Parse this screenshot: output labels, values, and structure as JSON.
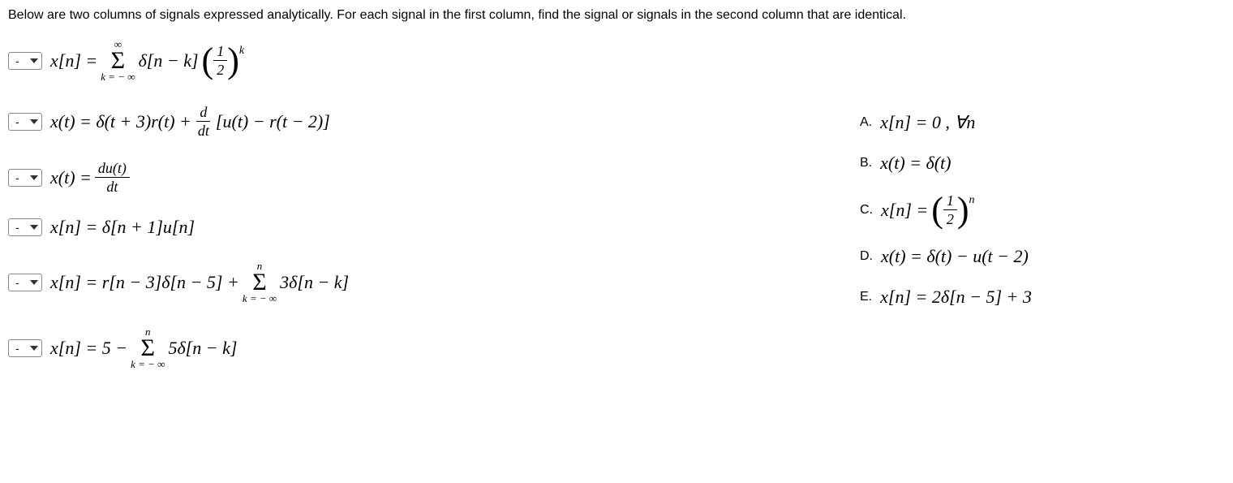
{
  "prompt": "Below are two columns of signals expressed analytically. For each signal in the first column, find the signal or signals in the second column that are identical.",
  "dropdown_value": "-",
  "questions": {
    "q1": {
      "x_label": "x[n] =",
      "sum_upper": "∞",
      "sum_lower": "k = − ∞",
      "body": "δ[n − k]",
      "frac_num": "1",
      "frac_den": "2",
      "exp": "k"
    },
    "q2": {
      "x_label": "x(t) = δ(t + 3)r(t) +",
      "frac_num": "d",
      "frac_den": "dt",
      "tail": "[u(t) − r(t − 2)]"
    },
    "q3": {
      "x_label": "x(t) =",
      "frac_num": "du(t)",
      "frac_den": "dt"
    },
    "q4": {
      "x_label": "x[n] = δ[n + 1]u[n]"
    },
    "q5": {
      "x_label": "x[n] = r[n − 3]δ[n − 5] +",
      "sum_upper": "n",
      "sum_lower": "k = − ∞",
      "tail": "3δ[n − k]"
    },
    "q6": {
      "x_label": "x[n] = 5 −",
      "sum_upper": "n",
      "sum_lower": "k = − ∞",
      "tail": "5δ[n − k]"
    }
  },
  "options": {
    "A": {
      "label": "A.",
      "text": "x[n] = 0 ,  ∀n"
    },
    "B": {
      "label": "B.",
      "text": "x(t) = δ(t)"
    },
    "C": {
      "label": "C.",
      "pre": "x[n] =",
      "frac_num": "1",
      "frac_den": "2",
      "exp": "n"
    },
    "D": {
      "label": "D.",
      "text": "x(t) = δ(t) − u(t − 2)"
    },
    "E": {
      "label": "E.",
      "text": "x[n] = 2δ[n − 5] + 3"
    }
  }
}
